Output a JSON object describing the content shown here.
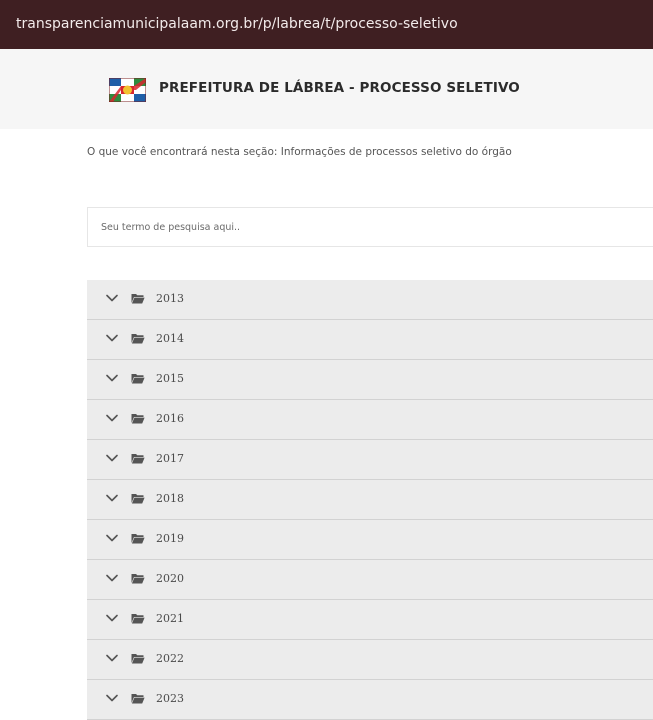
{
  "browser": {
    "url": "transparenciamunicipalaam.org.br/p/labrea/t/processo-seletivo"
  },
  "header": {
    "logo_icon": "municipal-flag-icon",
    "title": "PREFEITURA DE LÁBREA - PROCESSO SELETIVO"
  },
  "section": {
    "description": "O que você encontrará nesta seção: Informações de processos seletivo do órgão"
  },
  "search": {
    "placeholder": "Seu termo de pesquisa aqui..",
    "value": ""
  },
  "folders": {
    "icon": "folder-open-icon",
    "expand_icon": "chevron-down-icon",
    "items": [
      {
        "label": "2013"
      },
      {
        "label": "2014"
      },
      {
        "label": "2015"
      },
      {
        "label": "2016"
      },
      {
        "label": "2017"
      },
      {
        "label": "2018"
      },
      {
        "label": "2019"
      },
      {
        "label": "2020"
      },
      {
        "label": "2021"
      },
      {
        "label": "2022"
      },
      {
        "label": "2023"
      }
    ]
  },
  "colors": {
    "urlbar_bg": "#3f1f22",
    "header_bg": "#f6f6f6",
    "row_bg": "#ececec",
    "icon_gray": "#555555"
  }
}
